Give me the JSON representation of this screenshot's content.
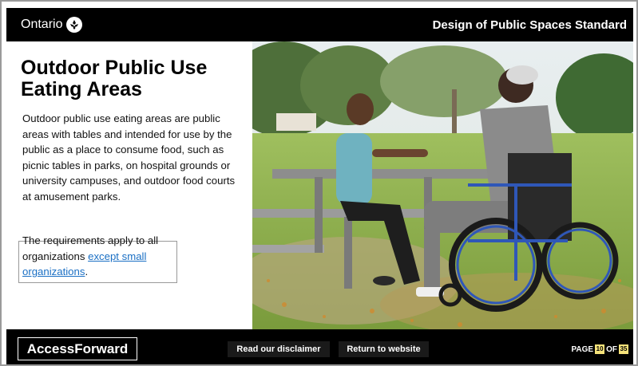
{
  "header": {
    "brand": "Ontario",
    "standard_title": "Design of Public Spaces Standard"
  },
  "content": {
    "heading": "Outdoor Public Use Eating Areas",
    "description": "Outdoor public use eating areas are public areas with tables and intended for use by the public as a place to consume food, such as picnic tables in parks, on hospital grounds or university campuses, and outdoor food courts at amusement parks.",
    "requirement_prefix": "The requirements apply to all organizations ",
    "requirement_link": "except small organizations",
    "requirement_suffix": "."
  },
  "footer": {
    "logo": "AccessForward",
    "disclaimer_button": "Read our disclaimer",
    "return_button": "Return to website",
    "page_label": "PAGE",
    "page_current": "10",
    "page_of": "OF",
    "page_total": "35"
  },
  "colors": {
    "bar": "#000000",
    "link": "#1a6fc4",
    "page_highlight": "#f5e27a"
  }
}
